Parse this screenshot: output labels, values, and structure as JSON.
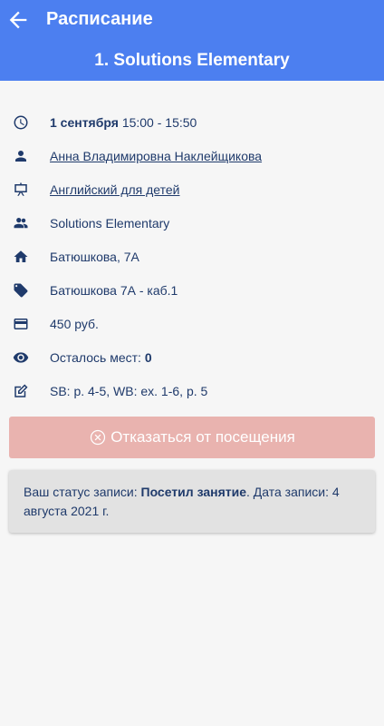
{
  "appbar": {
    "title": "Расписание",
    "subtitle": "1. Solutions Elementary"
  },
  "details": {
    "date": "1 сентября",
    "time": "15:00 - 15:50",
    "teacher": "Анна Владимировна Наклейщикова",
    "course": "Английский для детей",
    "group": "Solutions Elementary",
    "address": "Батюшкова, 7А",
    "room": "Батюшкова 7А - каб.1",
    "price": "450 руб.",
    "seats_label": "Осталось мест:",
    "seats_value": "0",
    "homework": "SB: p. 4-5, WB: ex. 1-6, p. 5"
  },
  "cancel_button": {
    "label": "Отказаться от посещения"
  },
  "status": {
    "prefix": "Ваш статус записи:",
    "value": "Посетил занятие",
    "date_label": ". Дата записи: 4 августа 2021 г."
  },
  "colors": {
    "appbar": "#4c7ff0",
    "text": "#1f3a6b",
    "link": "#4a80d8",
    "cancel": "#e9b3af"
  }
}
